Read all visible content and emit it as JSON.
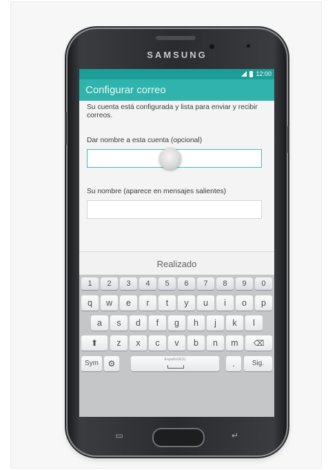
{
  "brand": "SAMSUNG",
  "status": {
    "time": "12:00"
  },
  "appbar": {
    "title": "Configurar correo"
  },
  "message": "Su cuenta está configurada y lista para enviar y recibir correos.",
  "account_name": {
    "label": "Dar nombre a esta cuenta (opcional)",
    "value": ""
  },
  "your_name": {
    "label": "Su nombre (aparece en mensajes salientes)",
    "value": ""
  },
  "done_label": "Realizado",
  "keyboard": {
    "numbers": [
      "1",
      "2",
      "3",
      "4",
      "5",
      "6",
      "7",
      "8",
      "9",
      "0"
    ],
    "row1": [
      "q",
      "w",
      "e",
      "r",
      "t",
      "y",
      "u",
      "i",
      "o",
      "p"
    ],
    "row2": [
      "a",
      "s",
      "d",
      "f",
      "g",
      "h",
      "j",
      "k",
      "l"
    ],
    "row3": [
      "z",
      "x",
      "c",
      "v",
      "b",
      "n",
      "m"
    ],
    "sym": "Sym",
    "space_lang": "Español(ES)",
    "period": ".",
    "next": "Sig."
  },
  "colors": {
    "statusbar": "#1d9d97",
    "appbar": "#2fb3ac",
    "accent": "#44b9b2"
  }
}
